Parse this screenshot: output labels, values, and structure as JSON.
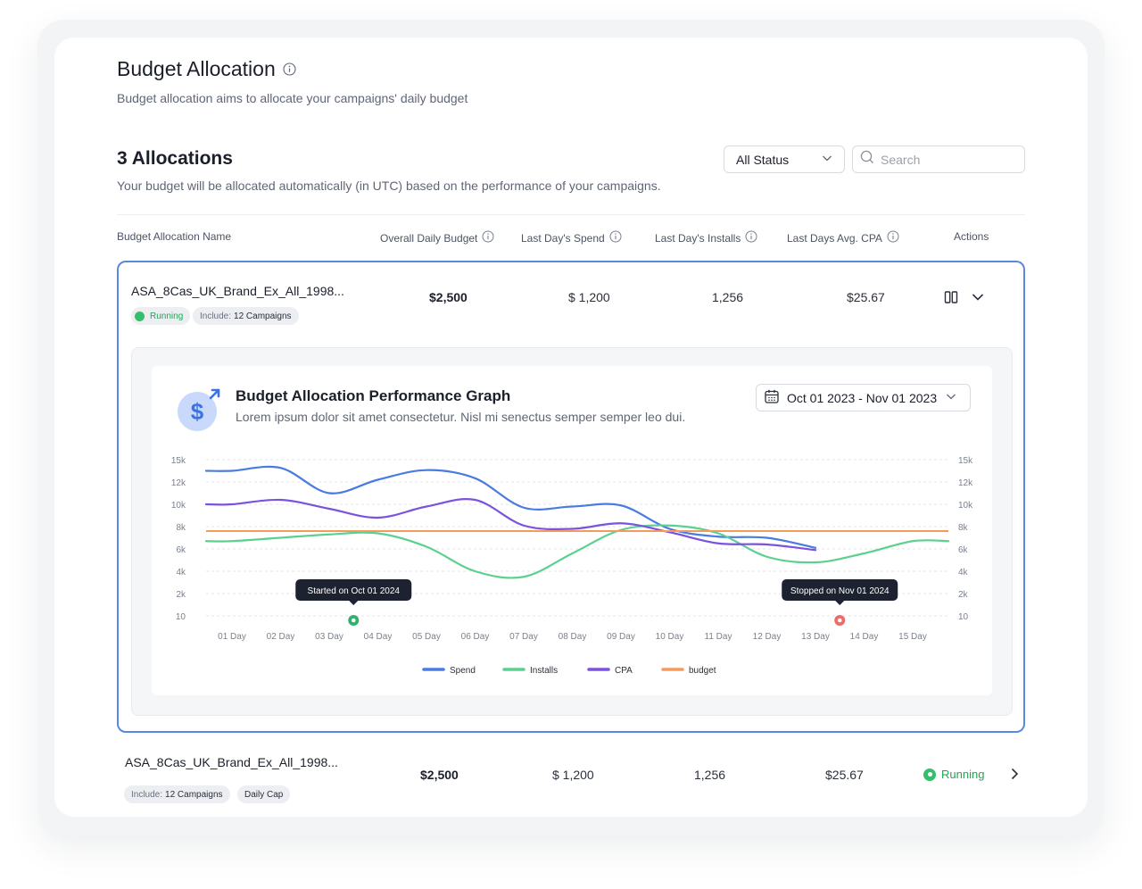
{
  "header": {
    "title": "Budget Allocation",
    "subtitle": "Budget allocation aims to allocate your campaigns' daily budget"
  },
  "allocations": {
    "title": "3 Allocations",
    "description": "Your budget will be allocated automatically (in UTC) based on the performance of your campaigns."
  },
  "filters": {
    "status_value": "All Status",
    "search_placeholder": "Search"
  },
  "table": {
    "columns": [
      "Budget Allocation Name",
      "Overall Daily Budget",
      "Last Day's Spend",
      "Last Day's Installs",
      "Last Days Avg. CPA",
      "Actions"
    ],
    "rows": [
      {
        "name": "ASA_8Cas_UK_Brand_Ex_All_1998...",
        "status": "Running",
        "include_label": "Include:",
        "include_value": "12 Campaigns",
        "budget": "$2,500",
        "spend": "$ 1,200",
        "installs": "1,256",
        "cpa": "$25.67"
      },
      {
        "name": "ASA_8Cas_UK_Brand_Ex_All_1998...",
        "status": "Running",
        "include_label": "Include:",
        "include_value": "12 Campaigns",
        "tag": "Daily Cap",
        "budget": "$2,500",
        "spend": "$ 1,200",
        "installs": "1,256",
        "cpa": "$25.67"
      }
    ]
  },
  "graph": {
    "title": "Budget Allocation Performance Graph",
    "subtitle": "Lorem ipsum dolor sit amet consectetur. Nisl mi senectus semper semper leo dui.",
    "date_range": "Oct 01 2023 - Nov 01 2023"
  },
  "chart_data": {
    "type": "line",
    "x": [
      "01 Day",
      "02 Day",
      "03 Day",
      "04 Day",
      "05 Day",
      "06 Day",
      "07  Day",
      "08 Day",
      "09 Day",
      "10 Day",
      "11 Day",
      "12 Day",
      "13 Day",
      "14 Day",
      "15 Day"
    ],
    "y_ticks": [
      "15k",
      "12k",
      "10k",
      "8k",
      "6k",
      "4k",
      "2k",
      "10"
    ],
    "series": [
      {
        "name": "Spend",
        "color": "#4a7be0",
        "values": [
          13500,
          13900,
          11000,
          12300,
          13600,
          12500,
          9700,
          9800,
          9900,
          7800,
          7100,
          7000,
          6100,
          null,
          null
        ]
      },
      {
        "name": "Installs",
        "color": "#5cd08f",
        "values": [
          6700,
          7000,
          7300,
          7400,
          6200,
          4000,
          3500,
          5600,
          7700,
          8100,
          7400,
          5300,
          4800,
          5600,
          6700
        ]
      },
      {
        "name": "CPA",
        "color": "#7b52de",
        "values": [
          10000,
          10400,
          9600,
          8800,
          9800,
          10400,
          8100,
          7800,
          8300,
          7500,
          6500,
          6400,
          5900,
          null,
          null
        ]
      },
      {
        "name": "budget",
        "color": "#f49a5a",
        "values": [
          7600,
          7600,
          7600,
          7600,
          7600,
          7600,
          7600,
          7600,
          7600,
          7600,
          7600,
          7600,
          7600,
          7600,
          7600
        ]
      }
    ],
    "annotations": [
      {
        "label": "Started on Oct 01 2024",
        "x_index": 2.5,
        "color": "#2fb36a"
      },
      {
        "label": "Stopped on Nov 01 2024",
        "x_index": 12.5,
        "color": "#ef6b6b"
      }
    ],
    "legend_position": "bottom"
  }
}
